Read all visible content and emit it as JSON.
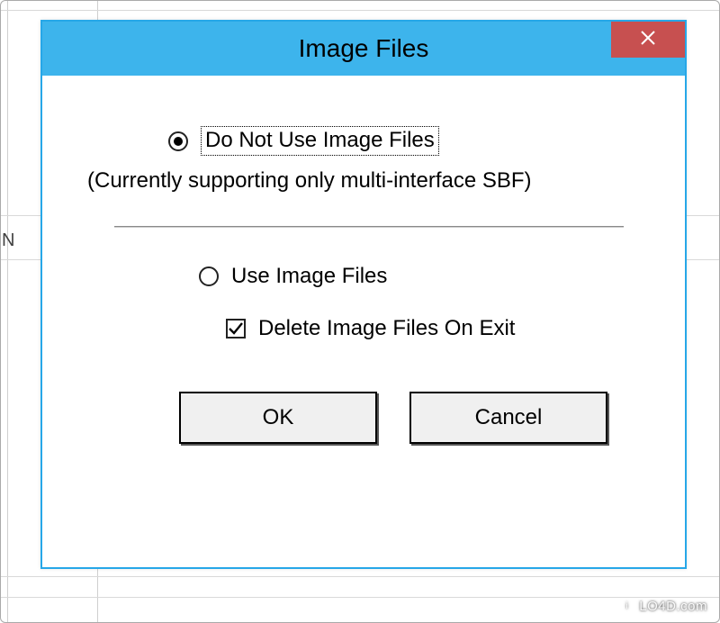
{
  "background": {
    "partial_text": "N"
  },
  "dialog": {
    "title": "Image Files",
    "close_symbol": "×",
    "radio_do_not_use": {
      "label": "Do Not Use Image Files",
      "selected": true
    },
    "radio_subtext": "(Currently supporting only multi-interface SBF)",
    "radio_use": {
      "label": "Use Image Files",
      "selected": false
    },
    "checkbox_delete": {
      "label": "Delete Image Files On Exit",
      "checked": true
    },
    "buttons": {
      "ok": "OK",
      "cancel": "Cancel"
    }
  },
  "watermark": "LO4D.com"
}
